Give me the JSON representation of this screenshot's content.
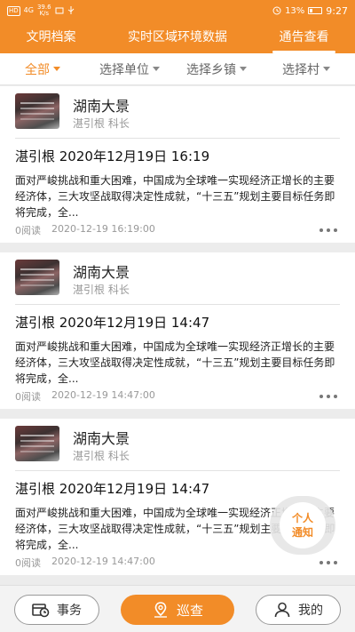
{
  "statusbar": {
    "hd": "HD",
    "network": "4G",
    "speed_value": "39.6",
    "speed_unit": "K/s",
    "battery": "13%",
    "time": "9:27"
  },
  "topnav": {
    "tabs": [
      {
        "label": "文明档案",
        "active": false
      },
      {
        "label": "实时区域环境数据",
        "active": false
      },
      {
        "label": "通告查看",
        "active": true
      }
    ]
  },
  "filters": [
    {
      "label": "全部",
      "active": true
    },
    {
      "label": "选择单位",
      "active": false
    },
    {
      "label": "选择乡镇",
      "active": false
    },
    {
      "label": "选择村",
      "active": false
    }
  ],
  "posts": [
    {
      "org": "湖南大景",
      "author": "湛引根 科长",
      "title": "湛引根 2020年12月19日 16:19",
      "body": "面对严峻挑战和重大困难，中国成为全球唯一实现经济正增长的主要经济体，三大攻坚战取得决定性成就，“十三五”规划主要目标任务即将完成，全...",
      "reads": "0阅读",
      "datetime": "2020-12-19 16:19:00"
    },
    {
      "org": "湖南大景",
      "author": "湛引根 科长",
      "title": "湛引根 2020年12月19日 14:47",
      "body": "面对严峻挑战和重大困难，中国成为全球唯一实现经济正增长的主要经济体，三大攻坚战取得决定性成就，“十三五”规划主要目标任务即将完成，全...",
      "reads": "0阅读",
      "datetime": "2020-12-19 14:47:00"
    },
    {
      "org": "湖南大景",
      "author": "湛引根 科长",
      "title": "湛引根 2020年12月19日 14:47",
      "body": "面对严峻挑战和重大困难，中国成为全球唯一实现经济正增长的主要经济体，三大攻坚战取得决定性成就，“十三五”规划主要目标任务即将完成，全...",
      "reads": "0阅读",
      "datetime": "2020-12-19 14:47:00"
    }
  ],
  "floating": {
    "line1": "个人",
    "line2": "通知"
  },
  "bottombar": {
    "affairs": "事务",
    "patrol": "巡查",
    "mine": "我的"
  },
  "colors": {
    "accent": "#f28c28"
  }
}
